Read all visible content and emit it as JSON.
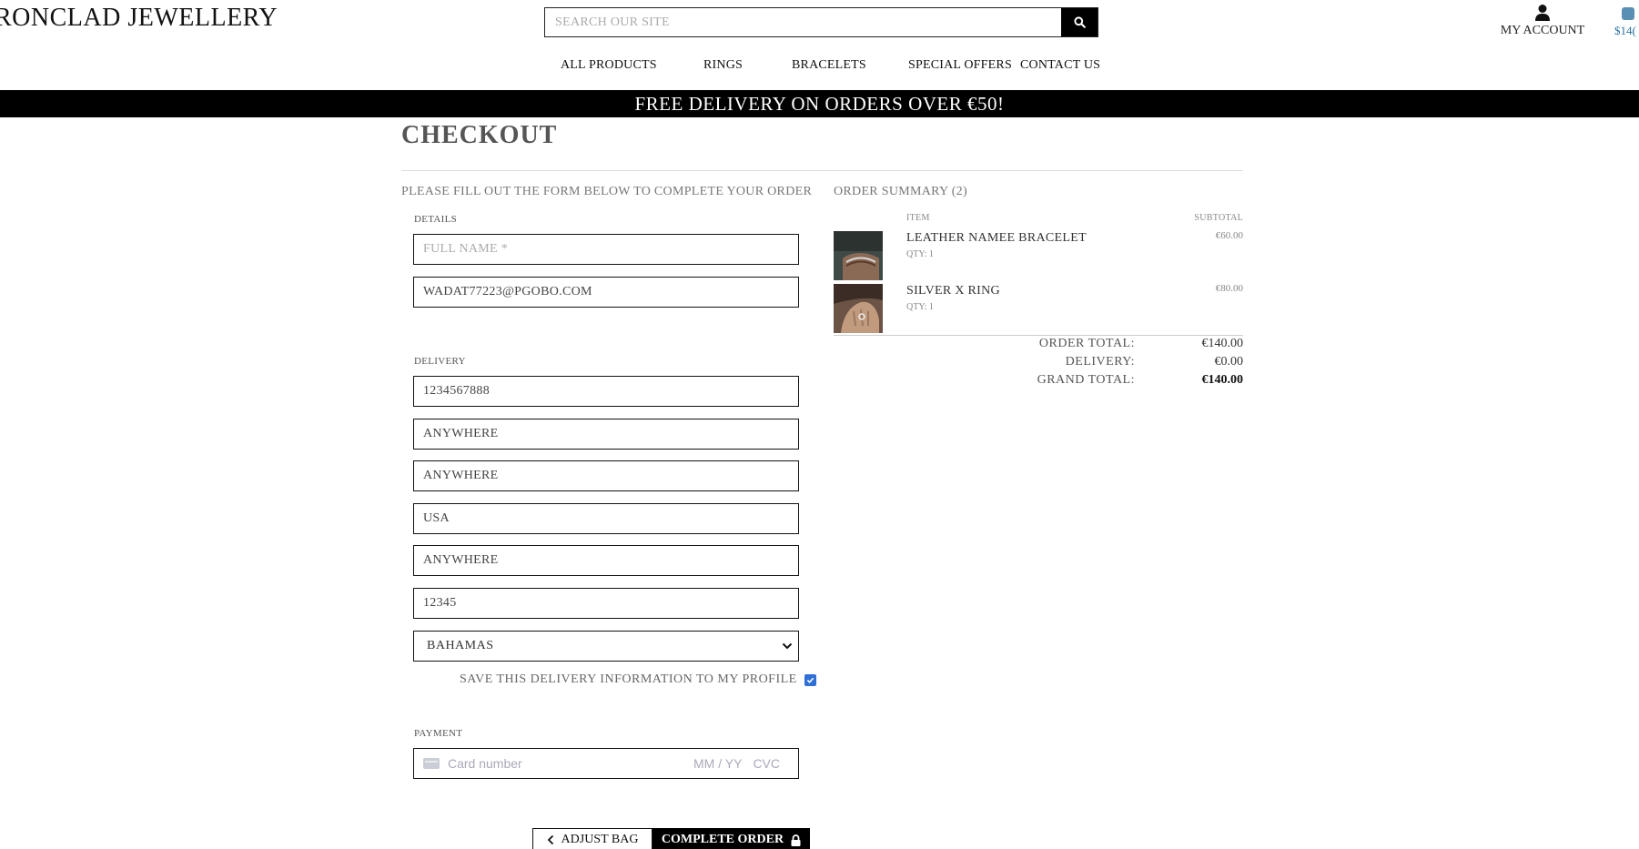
{
  "header": {
    "brand_bold": "RONCLAD",
    "brand_light": "JEWELLERY",
    "search_placeholder": "SEARCH OUR SITE",
    "account_label": "MY ACCOUNT",
    "bag_total": "$14("
  },
  "nav": {
    "items": [
      "ALL PRODUCTS",
      "RINGS",
      "BRACELETS",
      "SPECIAL OFFERS",
      "CONTACT US"
    ]
  },
  "banner": "FREE DELIVERY ON ORDERS OVER €50!",
  "checkout": {
    "title": "CHECKOUT",
    "intro": "PLEASE FILL OUT THE FORM BELOW TO COMPLETE YOUR ORDER",
    "details_legend": "DETAILS",
    "full_name_placeholder": "FULL NAME *",
    "email_value": "WADAT77223@PGOBO.COM",
    "delivery_legend": "DELIVERY",
    "phone_value": "1234567888",
    "address1_value": "ANYWHERE",
    "address2_value": "ANYWHERE",
    "city_value": "USA",
    "county_value": "ANYWHERE",
    "postcode_value": "12345",
    "country_value": "BAHAMAS",
    "save_label": "SAVE THIS DELIVERY INFORMATION TO MY PROFILE",
    "save_checked": true,
    "payment_legend": "PAYMENT",
    "card_placeholder": "Card number",
    "card_expiry_placeholder": "MM / YY",
    "card_cvc_placeholder": "CVC",
    "adjust_label": "ADJUST BAG",
    "complete_label": "COMPLETE ORDER"
  },
  "summary": {
    "title": "ORDER SUMMARY (2)",
    "col_item": "ITEM",
    "col_subtotal": "SUBTOTAL",
    "items": [
      {
        "name": "LEATHER NAMEE BRACELET",
        "qty": "QTY: 1",
        "price": "€60.00"
      },
      {
        "name": "SILVER X RING",
        "qty": "QTY: 1",
        "price": "€80.00"
      }
    ],
    "order_total_label": "ORDER TOTAL:",
    "order_total": "€140.00",
    "delivery_label": "DELIVERY:",
    "delivery": "€0.00",
    "grand_total_label": "GRAND TOTAL:",
    "grand_total": "€140.00"
  }
}
